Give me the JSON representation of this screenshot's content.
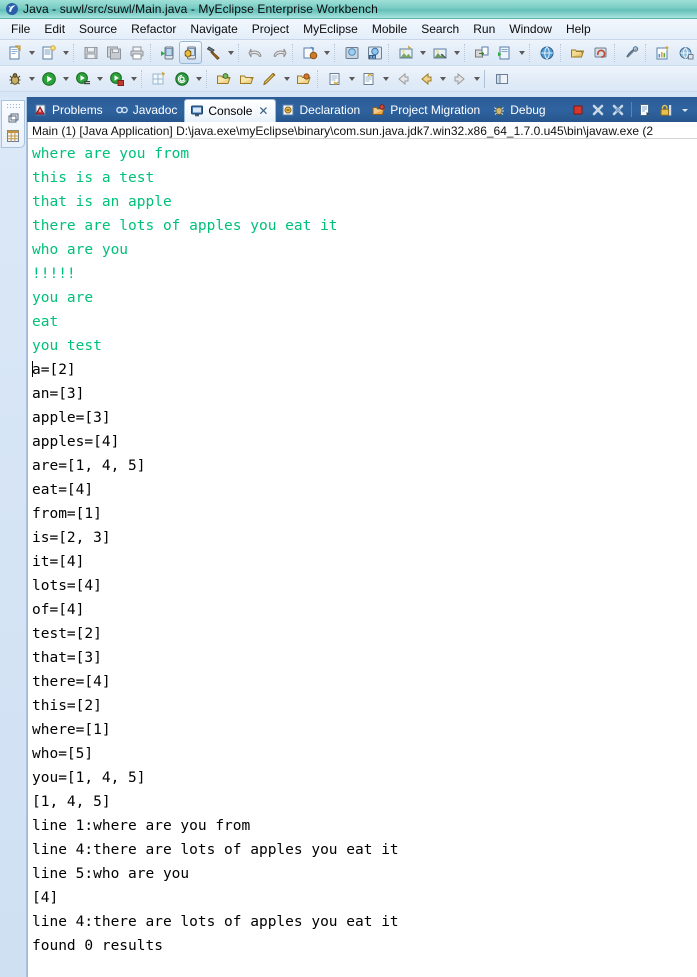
{
  "window": {
    "title": "Java - suwl/src/suwl/Main.java - MyEclipse Enterprise Workbench",
    "app_icon": "eclipse-java-icon",
    "titlebar_color": "#79ccc4"
  },
  "menubar": {
    "items": [
      {
        "label": "File"
      },
      {
        "label": "Edit"
      },
      {
        "label": "Source"
      },
      {
        "label": "Refactor"
      },
      {
        "label": "Navigate"
      },
      {
        "label": "Project"
      },
      {
        "label": "MyEclipse"
      },
      {
        "label": "Mobile"
      },
      {
        "label": "Search"
      },
      {
        "label": "Run"
      },
      {
        "label": "Window"
      },
      {
        "label": "Help"
      }
    ]
  },
  "toolbar_row1": {
    "items": [
      {
        "name": "new-file-icon",
        "kind": "button"
      },
      {
        "name": "dropdown-arrow-icon",
        "kind": "arrow"
      },
      {
        "name": "new-wizard-icon",
        "kind": "button"
      },
      {
        "name": "dropdown-arrow-icon",
        "kind": "arrow"
      },
      {
        "name": "separator",
        "kind": "sep"
      },
      {
        "name": "save-icon",
        "kind": "button"
      },
      {
        "name": "save-all-icon",
        "kind": "button"
      },
      {
        "name": "print-icon",
        "kind": "button"
      },
      {
        "name": "separator",
        "kind": "sep"
      },
      {
        "name": "run-on-device-icon",
        "kind": "button"
      },
      {
        "name": "debug-on-device-icon",
        "kind": "button-pressed"
      },
      {
        "name": "build-hammer-icon",
        "kind": "button"
      },
      {
        "name": "dropdown-arrow-icon",
        "kind": "arrow"
      },
      {
        "name": "separator",
        "kind": "sep"
      },
      {
        "name": "undo-icon",
        "kind": "button"
      },
      {
        "name": "redo-icon",
        "kind": "button"
      },
      {
        "name": "separator",
        "kind": "sep"
      },
      {
        "name": "deploy-icon",
        "kind": "button"
      },
      {
        "name": "dropdown-arrow-icon",
        "kind": "arrow"
      },
      {
        "name": "separator",
        "kind": "sep"
      },
      {
        "name": "server-icon",
        "kind": "button"
      },
      {
        "name": "html-30-icon",
        "kind": "button"
      },
      {
        "name": "separator",
        "kind": "sep"
      },
      {
        "name": "new-image-icon",
        "kind": "button"
      },
      {
        "name": "dropdown-arrow-icon",
        "kind": "arrow"
      },
      {
        "name": "open-image-icon",
        "kind": "button"
      },
      {
        "name": "dropdown-arrow-icon",
        "kind": "arrow"
      },
      {
        "name": "separator",
        "kind": "sep"
      },
      {
        "name": "export-icon",
        "kind": "button"
      },
      {
        "name": "run-report-icon",
        "kind": "button"
      },
      {
        "name": "dropdown-arrow-icon",
        "kind": "arrow"
      },
      {
        "name": "separator",
        "kind": "sep"
      },
      {
        "name": "globe-icon",
        "kind": "button"
      },
      {
        "name": "separator",
        "kind": "sep"
      },
      {
        "name": "open-browser-icon",
        "kind": "button"
      },
      {
        "name": "refresh-browser-icon",
        "kind": "button"
      },
      {
        "name": "separator",
        "kind": "sep"
      },
      {
        "name": "toggle-link-icon",
        "kind": "button"
      },
      {
        "name": "separator",
        "kind": "sep"
      },
      {
        "name": "new-report-icon",
        "kind": "button"
      },
      {
        "name": "world-wizard-icon",
        "kind": "button"
      },
      {
        "name": "dropdown-arrow-icon",
        "kind": "arrow"
      },
      {
        "name": "separator",
        "kind": "sep"
      }
    ]
  },
  "toolbar_row2": {
    "items": [
      {
        "name": "debug-bug-icon",
        "kind": "button"
      },
      {
        "name": "dropdown-arrow-icon",
        "kind": "arrow"
      },
      {
        "name": "run-icon",
        "kind": "button"
      },
      {
        "name": "dropdown-arrow-icon",
        "kind": "arrow"
      },
      {
        "name": "run-configurations-icon",
        "kind": "button"
      },
      {
        "name": "dropdown-arrow-icon",
        "kind": "arrow"
      },
      {
        "name": "profile-icon",
        "kind": "button"
      },
      {
        "name": "dropdown-arrow-icon",
        "kind": "arrow"
      },
      {
        "name": "separator",
        "kind": "sep"
      },
      {
        "name": "new-java-class-icon",
        "kind": "button"
      },
      {
        "name": "new-annotation-icon",
        "kind": "button"
      },
      {
        "name": "dropdown-arrow-icon",
        "kind": "arrow"
      },
      {
        "name": "separator",
        "kind": "sep"
      },
      {
        "name": "open-type-icon",
        "kind": "button"
      },
      {
        "name": "open-folder-icon",
        "kind": "button"
      },
      {
        "name": "quick-fix-icon",
        "kind": "button"
      },
      {
        "name": "dropdown-arrow-icon",
        "kind": "arrow"
      },
      {
        "name": "open-resource-icon",
        "kind": "button"
      },
      {
        "name": "separator",
        "kind": "sep"
      },
      {
        "name": "next-annotation-icon",
        "kind": "button"
      },
      {
        "name": "dropdown-arrow-icon",
        "kind": "arrow"
      },
      {
        "name": "previous-annotation-icon",
        "kind": "button"
      },
      {
        "name": "dropdown-arrow-icon",
        "kind": "arrow"
      },
      {
        "name": "back-icon",
        "kind": "button"
      },
      {
        "name": "back-history-icon",
        "kind": "button"
      },
      {
        "name": "dropdown-arrow-icon",
        "kind": "arrow"
      },
      {
        "name": "forward-icon",
        "kind": "button"
      },
      {
        "name": "dropdown-arrow-icon",
        "kind": "arrow"
      },
      {
        "name": "separator-solid",
        "kind": "sep-solid"
      },
      {
        "name": "open-perspective-icon",
        "kind": "button"
      }
    ]
  },
  "fastview": {
    "restore_icon": "restore-view-icon",
    "grid_icon": "grid-view-icon"
  },
  "view_tabs": {
    "items": [
      {
        "label": "Problems",
        "icon": "problems-icon",
        "active": false,
        "closable": false
      },
      {
        "label": "Javadoc",
        "icon": "javadoc-icon",
        "active": false,
        "closable": false
      },
      {
        "label": "Console",
        "icon": "console-icon",
        "active": true,
        "closable": true,
        "close_label": "✕"
      },
      {
        "label": "Declaration",
        "icon": "declaration-icon",
        "active": false,
        "closable": false
      },
      {
        "label": "Project Migration",
        "icon": "project-migration-icon",
        "active": false,
        "closable": false
      },
      {
        "label": "Debug",
        "icon": "debug-icon",
        "active": false,
        "closable": false
      }
    ],
    "tools": [
      {
        "name": "terminate-icon"
      },
      {
        "name": "remove-launch-icon"
      },
      {
        "name": "remove-all-terminated-icon"
      },
      {
        "name": "separator"
      },
      {
        "name": "display-selected-console-icon"
      },
      {
        "name": "scroll-lock-icon"
      },
      {
        "name": "view-menu-icon"
      }
    ]
  },
  "console": {
    "header": "Main (1) [Java Application] D:\\java.exe\\myEclipse\\binary\\com.sun.java.jdk7.win32.x86_64_1.7.0.u45\\bin\\javaw.exe (2",
    "output_color_green": "#00c07a",
    "output_color_black": "#000000",
    "lines": [
      {
        "text": "where are you from",
        "color": "green"
      },
      {
        "text": "this is a test",
        "color": "green"
      },
      {
        "text": "that is an apple",
        "color": "green"
      },
      {
        "text": "there are lots of apples you eat it",
        "color": "green"
      },
      {
        "text": "who are you",
        "color": "green"
      },
      {
        "text": "!!!!!",
        "color": "green"
      },
      {
        "text": "you are",
        "color": "green"
      },
      {
        "text": "eat",
        "color": "green"
      },
      {
        "text": "you test",
        "color": "green"
      },
      {
        "text": "a=[2]",
        "color": "black",
        "caret": true
      },
      {
        "text": "an=[3]",
        "color": "black"
      },
      {
        "text": "apple=[3]",
        "color": "black"
      },
      {
        "text": "apples=[4]",
        "color": "black"
      },
      {
        "text": "are=[1, 4, 5]",
        "color": "black"
      },
      {
        "text": "eat=[4]",
        "color": "black"
      },
      {
        "text": "from=[1]",
        "color": "black"
      },
      {
        "text": "is=[2, 3]",
        "color": "black"
      },
      {
        "text": "it=[4]",
        "color": "black"
      },
      {
        "text": "lots=[4]",
        "color": "black"
      },
      {
        "text": "of=[4]",
        "color": "black"
      },
      {
        "text": "test=[2]",
        "color": "black"
      },
      {
        "text": "that=[3]",
        "color": "black"
      },
      {
        "text": "there=[4]",
        "color": "black"
      },
      {
        "text": "this=[2]",
        "color": "black"
      },
      {
        "text": "where=[1]",
        "color": "black"
      },
      {
        "text": "who=[5]",
        "color": "black"
      },
      {
        "text": "you=[1, 4, 5]",
        "color": "black"
      },
      {
        "text": "[1, 4, 5]",
        "color": "black"
      },
      {
        "text": "line 1:where are you from",
        "color": "black"
      },
      {
        "text": "line 4:there are lots of apples you eat it",
        "color": "black"
      },
      {
        "text": "line 5:who are you",
        "color": "black"
      },
      {
        "text": "[4]",
        "color": "black"
      },
      {
        "text": "line 4:there are lots of apples you eat it",
        "color": "black"
      },
      {
        "text": "found 0 results",
        "color": "black"
      }
    ]
  }
}
